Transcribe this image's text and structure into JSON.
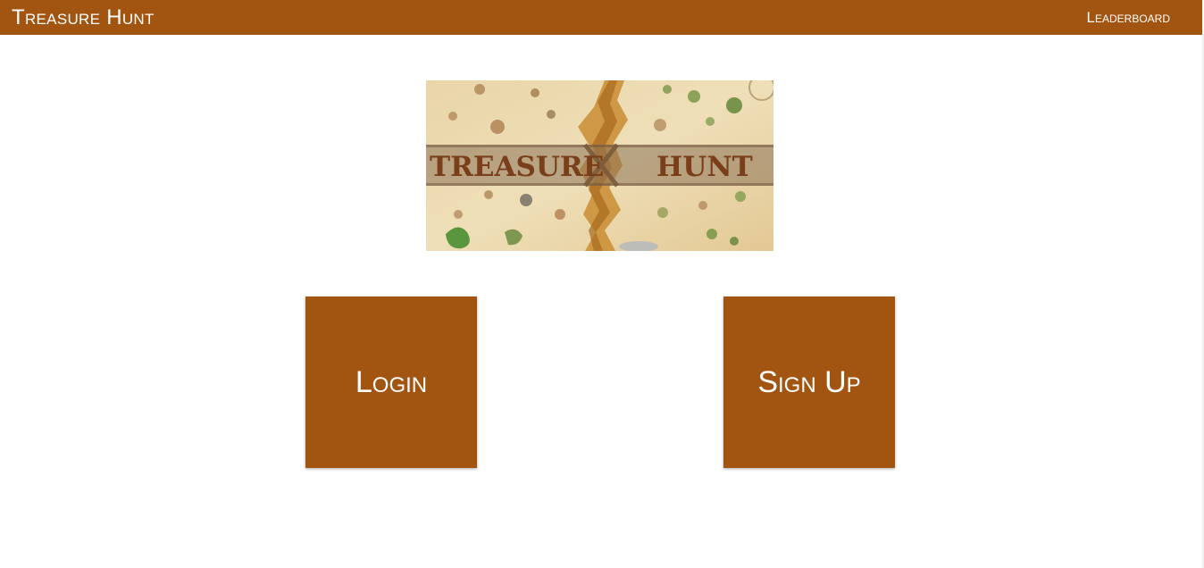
{
  "navbar": {
    "brand": "Treasure Hunt",
    "leaderboard_link": "Leaderboard"
  },
  "banner": {
    "word_left": "TREASURE",
    "word_right": "HUNT"
  },
  "tiles": {
    "login_label": "Login",
    "signup_label": "Sign Up"
  },
  "colors": {
    "brand": "#a25511",
    "background": "#ffffff",
    "text_on_brand": "#ffffff"
  }
}
